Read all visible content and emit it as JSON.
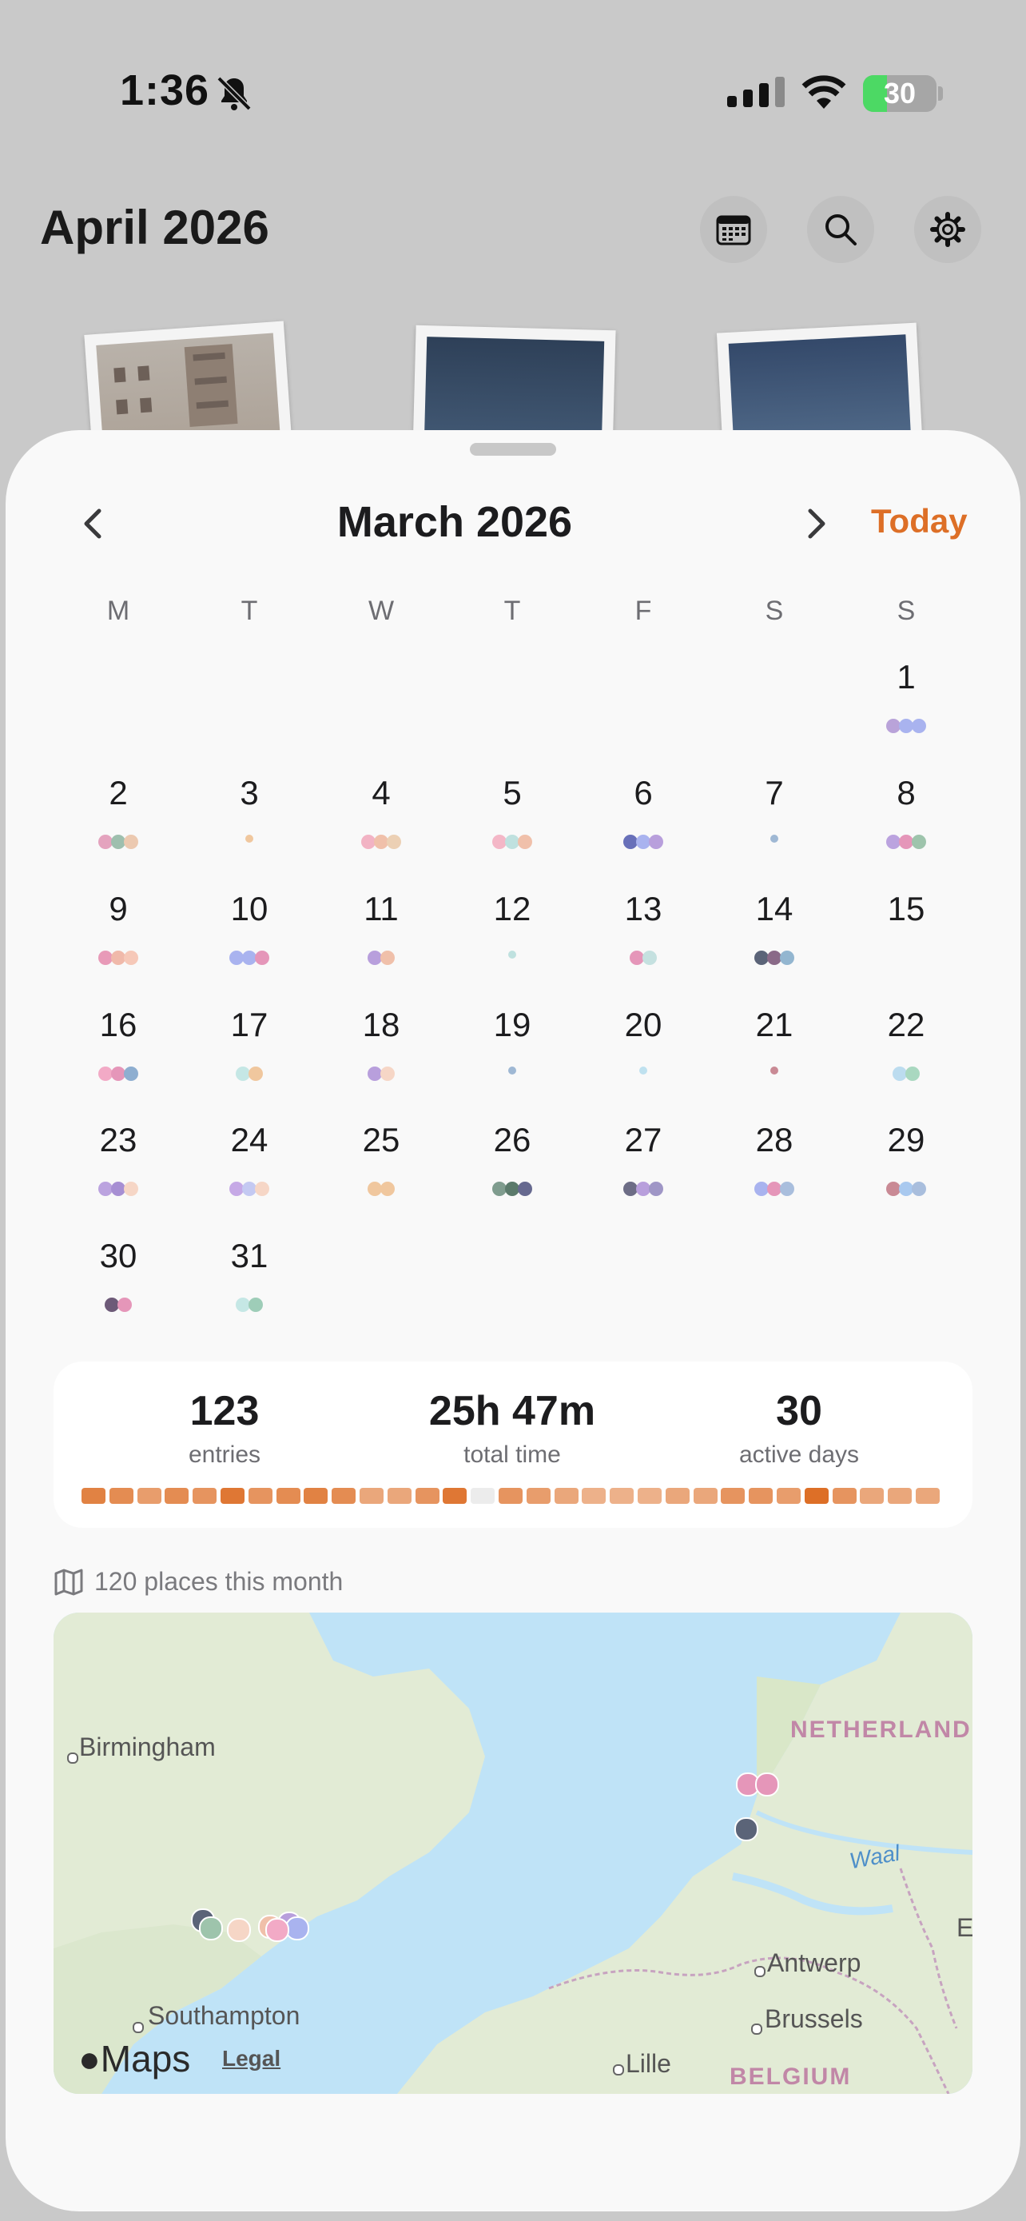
{
  "status_bar": {
    "time": "1:36",
    "battery": "30"
  },
  "header": {
    "title": "April 2026"
  },
  "calendar": {
    "month_title": "March 2026",
    "today_label": "Today",
    "weekdays": [
      "M",
      "T",
      "W",
      "T",
      "F",
      "S",
      "S"
    ],
    "days": [
      {
        "n": "1",
        "dots": [
          "#b9a3d9",
          "#a9b3ef",
          "#a9b3ef"
        ]
      },
      {
        "n": "2",
        "dots": [
          "#e4a3be",
          "#9ebfae",
          "#ecc9b0"
        ]
      },
      {
        "n": "3",
        "dots": [
          "#f0c79e"
        ]
      },
      {
        "n": "4",
        "dots": [
          "#f2b3c4",
          "#f0c0aa",
          "#ecd0b4"
        ]
      },
      {
        "n": "5",
        "dots": [
          "#f4b7c7",
          "#bfe1df",
          "#f0c0aa"
        ]
      },
      {
        "n": "6",
        "dots": [
          "#6870b9",
          "#a9b3ef",
          "#b89fdc"
        ]
      },
      {
        "n": "7",
        "dots": [
          "#9fb8d4"
        ]
      },
      {
        "n": "8",
        "dots": [
          "#bba3df",
          "#e596b9",
          "#9ec4ac"
        ]
      },
      {
        "n": "9",
        "dots": [
          "#e89ab8",
          "#f0b9aa",
          "#f6c8b8"
        ]
      },
      {
        "n": "10",
        "dots": [
          "#a9b3ef",
          "#a9b3ef",
          "#e596b9"
        ]
      },
      {
        "n": "11",
        "dots": [
          "#b89fdc",
          "#f0c0aa"
        ]
      },
      {
        "n": "12",
        "dots": [
          "#bfe1df"
        ]
      },
      {
        "n": "13",
        "dots": [
          "#e596b9",
          "#c5e1e0"
        ]
      },
      {
        "n": "14",
        "dots": [
          "#5b6478",
          "#8a6a88",
          "#93b6d0"
        ]
      },
      {
        "n": "15",
        "dots": []
      },
      {
        "n": "16",
        "dots": [
          "#f2aac6",
          "#e596b9",
          "#8eaed0"
        ]
      },
      {
        "n": "17",
        "dots": [
          "#c5e7e5",
          "#f0c79e"
        ]
      },
      {
        "n": "18",
        "dots": [
          "#b89fdc",
          "#f6d6c6"
        ]
      },
      {
        "n": "19",
        "dots": [
          "#9fb8d4"
        ]
      },
      {
        "n": "20",
        "dots": [
          "#bfe1ef"
        ]
      },
      {
        "n": "21",
        "dots": [
          "#c98a95"
        ]
      },
      {
        "n": "22",
        "dots": [
          "#bcdcef",
          "#a9d8c0"
        ]
      },
      {
        "n": "23",
        "dots": [
          "#bba3df",
          "#a78fd3",
          "#f6d6c6"
        ]
      },
      {
        "n": "24",
        "dots": [
          "#c6a9e6",
          "#c4c9f2",
          "#f6d6c6"
        ]
      },
      {
        "n": "25",
        "dots": [
          "#f0c79e",
          "#f0c79e"
        ]
      },
      {
        "n": "26",
        "dots": [
          "#7f9c8e",
          "#5b7a6b",
          "#66698f"
        ]
      },
      {
        "n": "27",
        "dots": [
          "#6d6d86",
          "#b89fdc",
          "#9f96c6"
        ]
      },
      {
        "n": "28",
        "dots": [
          "#a9b3ef",
          "#e596b9",
          "#a9bedd"
        ]
      },
      {
        "n": "29",
        "dots": [
          "#c98a95",
          "#a9c9ef",
          "#a9bedd"
        ]
      },
      {
        "n": "30",
        "dots": [
          "#6d5a78",
          "#e596b9"
        ]
      },
      {
        "n": "31",
        "dots": [
          "#c5e7e5",
          "#9ecdb8"
        ]
      }
    ]
  },
  "stats": {
    "entries_value": "123",
    "entries_label": "entries",
    "time_value": "25h 47m",
    "time_label": "total time",
    "days_value": "30",
    "days_label": "active days",
    "activity_levels": [
      0.8,
      0.7,
      0.5,
      0.7,
      0.6,
      0.9,
      0.6,
      0.7,
      0.8,
      0.7,
      0.4,
      0.4,
      0.6,
      0.9,
      0.0,
      0.6,
      0.5,
      0.4,
      0.3,
      0.3,
      0.3,
      0.4,
      0.4,
      0.6,
      0.6,
      0.5,
      1.0,
      0.6,
      0.4,
      0.4,
      0.4
    ]
  },
  "places": {
    "label": "120 places this month"
  },
  "map": {
    "labels": {
      "birmingham": "Birmingham",
      "netherlands": "NETHERLAND",
      "waal": "Waal",
      "antwerp": "Antwerp",
      "brussels": "Brussels",
      "southampton": "Southampton",
      "lille": "Lille",
      "belgium": "BELGIUM",
      "edge_e": "E"
    },
    "brand": "Maps",
    "legal": "Legal"
  },
  "colors": {
    "accent": "#dd6f27",
    "sheet": "#f9f9f9",
    "backdrop": "#c9c9c9"
  }
}
